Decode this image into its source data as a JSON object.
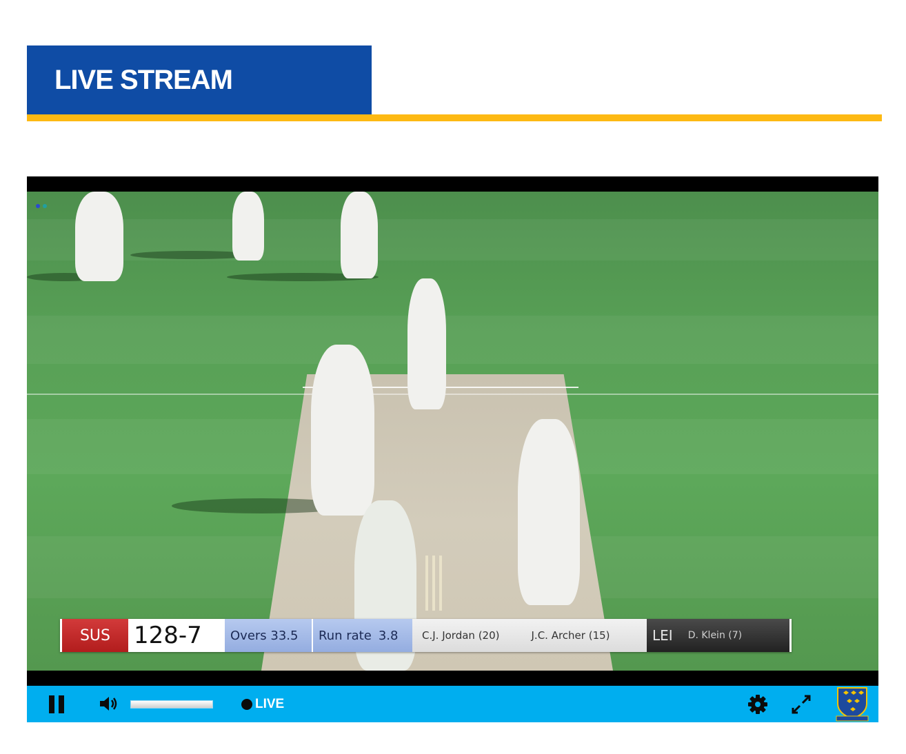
{
  "header": {
    "title": "LIVE STREAM"
  },
  "colors": {
    "header_blue": "#0f4ca5",
    "accent_gold": "#fdb913",
    "control_blue": "#00aeef",
    "home_red": "#c62828"
  },
  "scoreboard": {
    "home_team": "SUS",
    "score": "128-7",
    "overs": "Overs 33.5",
    "run_rate_label": "Run rate",
    "run_rate_value": "3.8",
    "batter_1": "C.J. Jordan (20)",
    "batter_2": "J.C. Archer (15)",
    "bowling_team": "LEI",
    "bowler": "D. Klein (7)"
  },
  "controls": {
    "live_label": "LIVE",
    "volume_level": 1.0,
    "icons": [
      "pause-icon",
      "volume-icon",
      "gear-icon",
      "fullscreen-icon",
      "sussex-crest-logo"
    ]
  }
}
